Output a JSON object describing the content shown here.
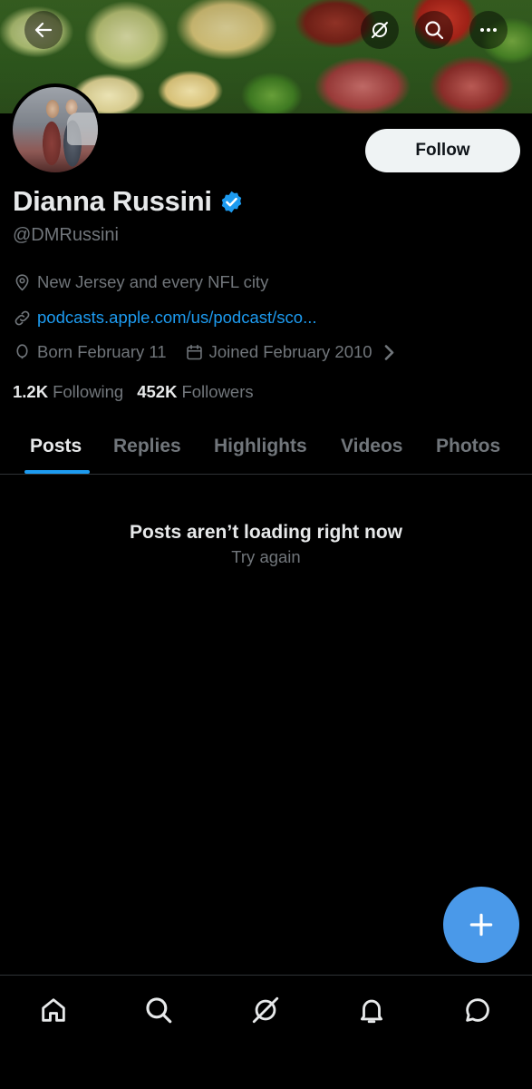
{
  "profile": {
    "display_name": "Dianna Russini",
    "handle": "@DMRussini",
    "location": "New Jersey and every NFL city",
    "website": "podcasts.apple.com/us/podcast/sco...",
    "born": "Born February 11",
    "joined": "Joined February 2010",
    "follow_label": "Follow"
  },
  "stats": {
    "following_count": "1.2K",
    "following_label": "Following",
    "followers_count": "452K",
    "followers_label": "Followers"
  },
  "tabs": [
    {
      "label": "Posts"
    },
    {
      "label": "Replies"
    },
    {
      "label": "Highlights"
    },
    {
      "label": "Videos"
    },
    {
      "label": "Photos"
    }
  ],
  "feed": {
    "empty_title": "Posts aren’t loading right now",
    "retry_label": "Try again"
  },
  "icons": {
    "top_bar": [
      "back-arrow-icon",
      "grok-icon",
      "search-icon",
      "more-icon"
    ],
    "bottom_nav": [
      "home-icon",
      "search-icon",
      "grok-icon",
      "notifications-icon",
      "messages-icon"
    ],
    "fab": "plus-icon"
  },
  "colors": {
    "accent": "#1d9bf0",
    "fab": "#4a99e9",
    "muted_text": "#71767b",
    "primary_text": "#e7e9ea"
  }
}
